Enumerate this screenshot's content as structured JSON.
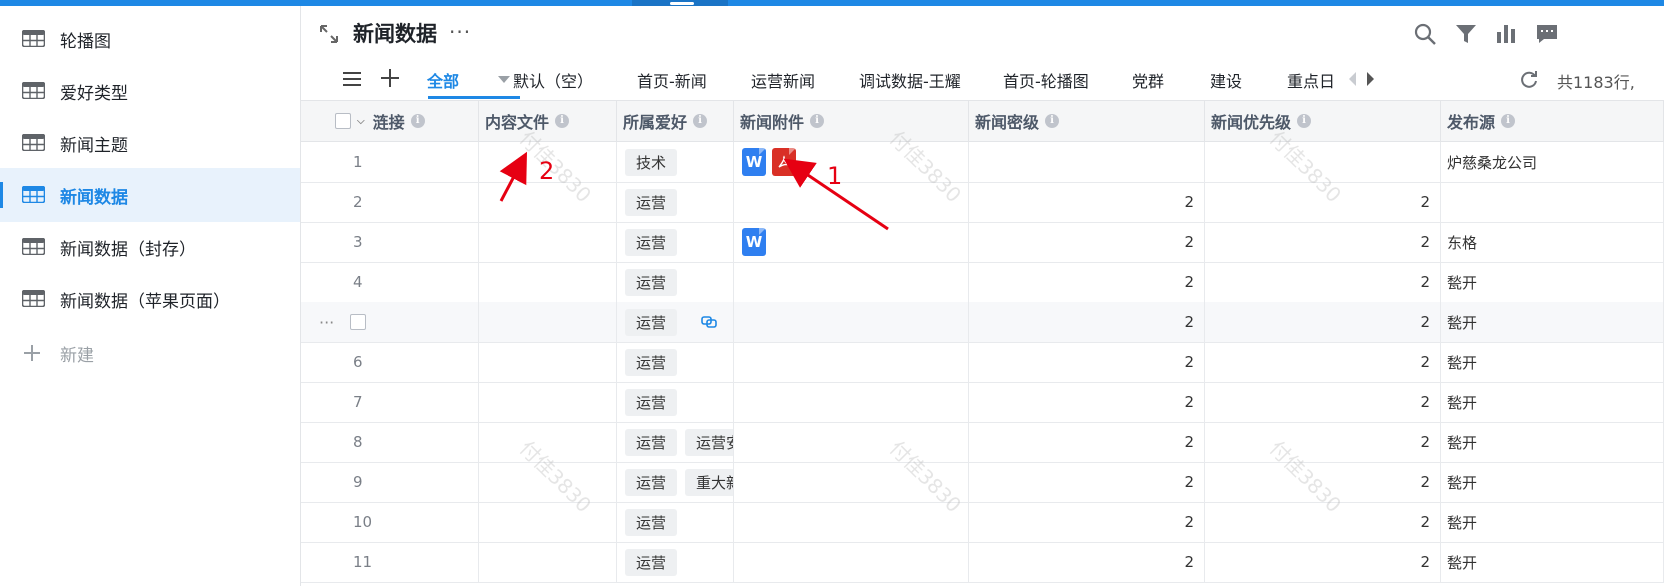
{
  "sidebar": {
    "items": [
      {
        "label": "轮播图",
        "active": false
      },
      {
        "label": "爱好类型",
        "active": false
      },
      {
        "label": "新闻主题",
        "active": false
      },
      {
        "label": "新闻数据",
        "active": true
      },
      {
        "label": "新闻数据（封存）",
        "active": false
      },
      {
        "label": "新闻数据（苹果页面）",
        "active": false
      }
    ],
    "new_label": "新建"
  },
  "header": {
    "title": "新闻数据",
    "more": "···"
  },
  "tabs": [
    {
      "label": "全部",
      "active": true
    },
    {
      "label": "默认（空）"
    },
    {
      "label": "首页-新闻"
    },
    {
      "label": "运营新闻"
    },
    {
      "label": "调试数据-王耀"
    },
    {
      "label": "首页-轮播图"
    },
    {
      "label": "党群"
    },
    {
      "label": "建设"
    },
    {
      "label": "重点日"
    }
  ],
  "row_count": "共1183行,",
  "columns": [
    "涟接",
    "内容文件",
    "所属爱好",
    "新闻附件",
    "新闻密级",
    "新闻优先级",
    "发布源"
  ],
  "info_glyph": "i",
  "rows": [
    {
      "num": "1",
      "tags": [
        "技术"
      ],
      "files": [
        "W",
        "pdf"
      ],
      "secret": "",
      "priority": "",
      "source": "炉慈桑龙公司"
    },
    {
      "num": "2",
      "tags": [
        "运营"
      ],
      "files": [],
      "secret": "2",
      "priority": "2",
      "source": ""
    },
    {
      "num": "3",
      "tags": [
        "运营"
      ],
      "files": [
        "W"
      ],
      "secret": "2",
      "priority": "2",
      "source": "东格"
    },
    {
      "num": "4",
      "tags": [
        "运营"
      ],
      "files": [],
      "secret": "2",
      "priority": "2",
      "source": "甃开"
    },
    {
      "num": "",
      "tags": [
        "运营"
      ],
      "files": [],
      "secret": "2",
      "priority": "2",
      "source": "甃开",
      "hover": true
    },
    {
      "num": "6",
      "tags": [
        "运营"
      ],
      "files": [],
      "secret": "2",
      "priority": "2",
      "source": "甃开"
    },
    {
      "num": "7",
      "tags": [
        "运营"
      ],
      "files": [],
      "secret": "2",
      "priority": "2",
      "source": "甃开"
    },
    {
      "num": "8",
      "tags": [
        "运营",
        "运营安"
      ],
      "files": [],
      "secret": "2",
      "priority": "2",
      "source": "甃开"
    },
    {
      "num": "9",
      "tags": [
        "运营",
        "重大新"
      ],
      "files": [],
      "secret": "2",
      "priority": "2",
      "source": "甃开"
    },
    {
      "num": "10",
      "tags": [
        "运营"
      ],
      "files": [],
      "secret": "2",
      "priority": "2",
      "source": "甃开"
    },
    {
      "num": "11",
      "tags": [
        "运营"
      ],
      "files": [],
      "secret": "2",
      "priority": "2",
      "source": "甃开"
    }
  ],
  "annotations": {
    "a1": "1",
    "a2": "2"
  },
  "watermark": "付佳3830",
  "colors": {
    "accent": "#1e88e5",
    "word": "#2f7ff0",
    "pdf": "#d93026",
    "annotation": "#e60012"
  }
}
